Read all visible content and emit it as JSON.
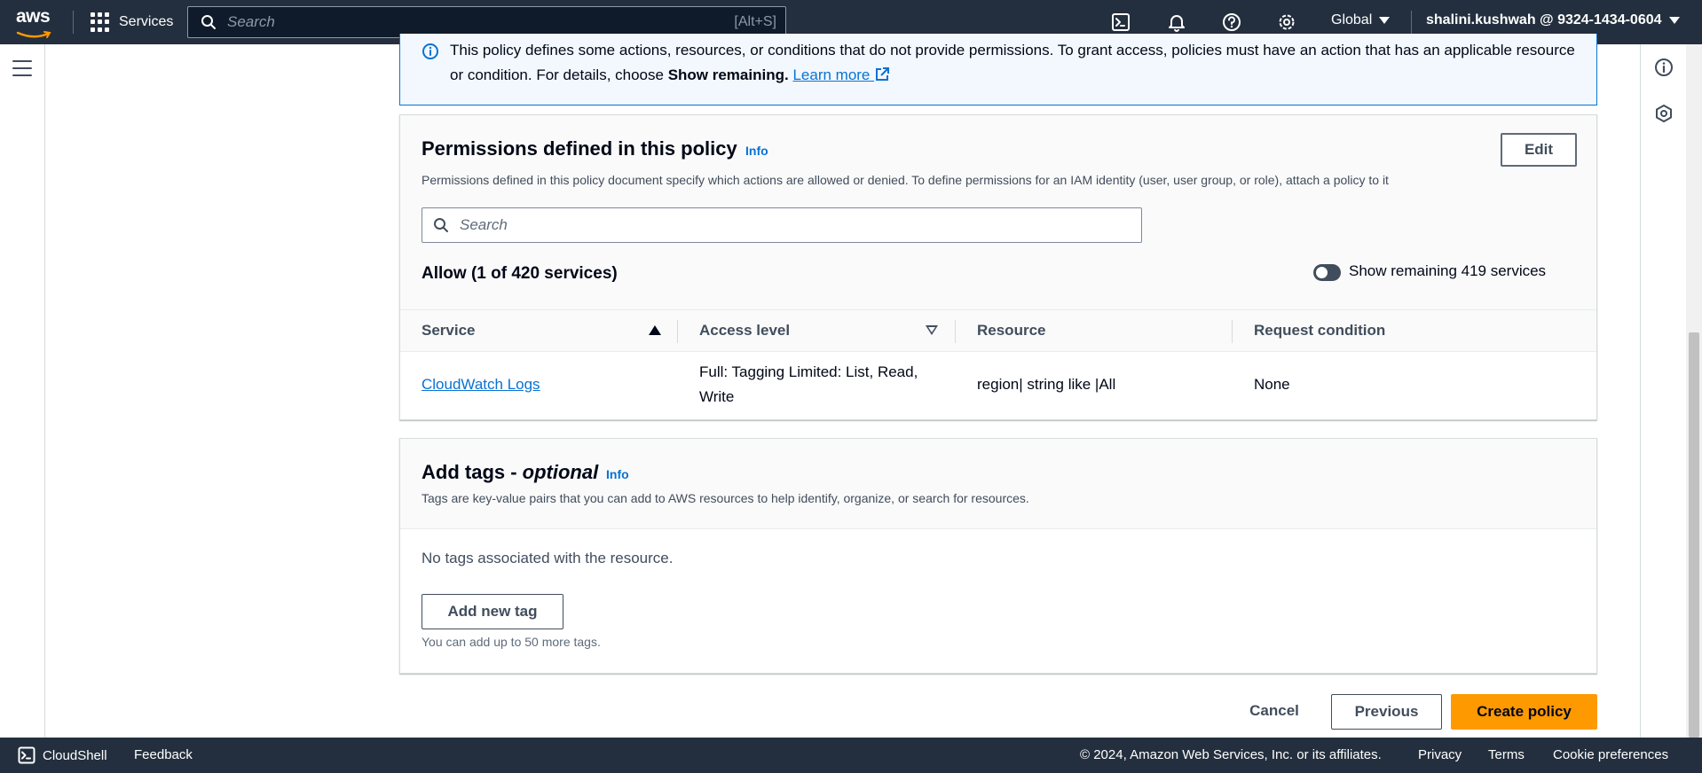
{
  "topnav": {
    "logo_text": "aws",
    "services_label": "Services",
    "search_placeholder": "Search",
    "search_shortcut": "[Alt+S]",
    "region_label": "Global",
    "account_label": "shalini.kushwah @ 9324-1434-0604"
  },
  "alert": {
    "text_part1": "This policy defines some actions, resources, or conditions that do not provide permissions. To grant access, policies must have an action that has an applicable resource or condition. For details, choose ",
    "text_bold": "Show remaining.",
    "learn_more": "Learn more"
  },
  "permissions": {
    "title": "Permissions defined in this policy",
    "info": "Info",
    "edit_label": "Edit",
    "description": "Permissions defined in this policy document specify which actions are allowed or denied. To define permissions for an IAM identity (user, user group, or role), attach a policy to it",
    "search_placeholder": "Search",
    "allow_title": "Allow (1 of 420 services)",
    "toggle_label": "Show remaining 419 services",
    "columns": {
      "service": "Service",
      "access_level": "Access level",
      "resource": "Resource",
      "request_condition": "Request condition"
    },
    "rows": [
      {
        "service": "CloudWatch Logs",
        "access_level": "Full: Tagging Limited: List, Read, Write",
        "resource": "region| string like |All",
        "request_condition": "None"
      }
    ]
  },
  "tags": {
    "title": "Add tags - ",
    "title_italic": "optional",
    "info": "Info",
    "description": "Tags are key-value pairs that you can add to AWS resources to help identify, organize, or search for resources.",
    "empty_message": "No tags associated with the resource.",
    "add_button": "Add new tag",
    "hint": "You can add up to 50 more tags."
  },
  "actions": {
    "cancel": "Cancel",
    "previous": "Previous",
    "create": "Create policy"
  },
  "footer": {
    "cloudshell": "CloudShell",
    "feedback": "Feedback",
    "copyright": "© 2024, Amazon Web Services, Inc. or its affiliates.",
    "privacy": "Privacy",
    "terms": "Terms",
    "cookie": "Cookie preferences"
  },
  "colors": {
    "nav_bg": "#232f3e",
    "link": "#0972d3",
    "primary": "#ff9900",
    "alert_bg": "#f2f8fd"
  }
}
